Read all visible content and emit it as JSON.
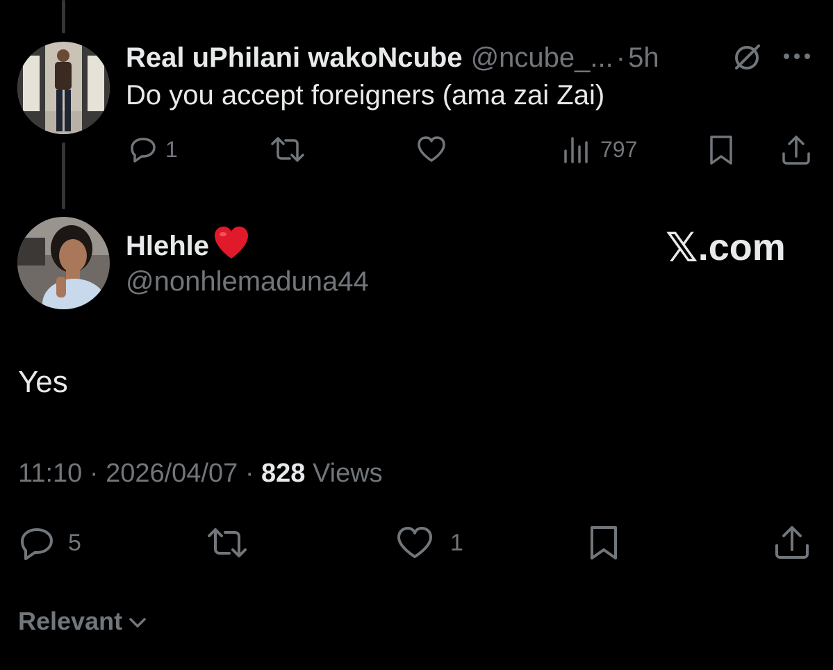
{
  "parent_tweet": {
    "display_name": "Real uPhilani wakoNcube",
    "handle": "@ncube_...",
    "separator": "·",
    "time": "5h",
    "text": "Do you accept foreigners (ama zai Zai)",
    "actions": {
      "replies": "1",
      "views": "797"
    },
    "icons": [
      "reply-icon",
      "retweet-icon",
      "like-icon",
      "views-icon",
      "bookmark-icon",
      "share-icon",
      "grok-icon",
      "more-icon"
    ]
  },
  "main_tweet": {
    "display_name": "Hlehle",
    "name_emoji": "❤️",
    "handle": "@nonhlemaduna44",
    "text": "Yes",
    "time": "11:10",
    "date": "2026/04/07",
    "separator": "·",
    "views_count": "828",
    "views_label": "Views",
    "actions": {
      "replies": "5",
      "likes": "1"
    }
  },
  "watermark": {
    "x_glyph": "𝕏",
    "text": ".com"
  },
  "sort": {
    "label": "Relevant"
  },
  "colors": {
    "background": "#000000",
    "primary_text": "#e7e9ea",
    "secondary_text": "#71767b",
    "thread_line": "#333639"
  }
}
